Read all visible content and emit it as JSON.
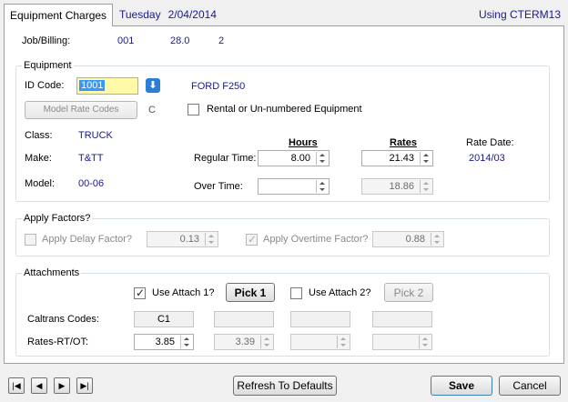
{
  "tabs": {
    "active_label": "Equipment Charges",
    "day": "Tuesday",
    "date": "2/04/2014",
    "using": "Using CTERM13"
  },
  "job": {
    "label": "Job/Billing:",
    "v1": "001",
    "v2": "28.0",
    "v3": "2"
  },
  "equipment": {
    "legend": "Equipment",
    "id_label": "ID Code:",
    "id_value": "1001",
    "description": "FORD F250",
    "model_rate_button": "Model Rate Codes",
    "rate_code": "C",
    "rental_label": "Rental or Un-numbered Equipment",
    "rental_checked": false,
    "class_label": "Class:",
    "class_value": "TRUCK",
    "make_label": "Make:",
    "make_value": "T&TT",
    "model_label": "Model:",
    "model_value": "00-06",
    "hours_header": "Hours",
    "rates_header": "Rates",
    "regular_label": "Regular Time:",
    "regular_hours": "8.00",
    "regular_rate": "21.43",
    "overtime_label": "Over Time:",
    "overtime_hours": "",
    "overtime_rate": "18.86",
    "rate_date_label": "Rate Date:",
    "rate_date_value": "2014/03"
  },
  "factors": {
    "legend": "Apply Factors?",
    "delay_label": "Apply Delay Factor?",
    "delay_checked": false,
    "delay_value": "0.13",
    "overtime_label": "Apply Overtime Factor?",
    "overtime_checked": true,
    "overtime_value": "0.88"
  },
  "attachments": {
    "legend": "Attachments",
    "attach1_label": "Use Attach 1?",
    "attach1_checked": true,
    "pick1": "Pick 1",
    "attach2_label": "Use Attach 2?",
    "attach2_checked": false,
    "pick2": "Pick 2",
    "caltrans_label": "Caltrans Codes:",
    "caltrans1": "C1",
    "rates_label": "Rates-RT/OT:",
    "rate1_rt": "3.85",
    "rate1_ot": "3.39"
  },
  "footer": {
    "refresh": "Refresh To Defaults",
    "save": "Save",
    "cancel": "Cancel",
    "nav_first": "|◀",
    "nav_prev": "◀",
    "nav_next": "▶",
    "nav_last": "▶|"
  },
  "colors": {
    "accent": "#1a1a8c",
    "id_highlight": "#fff9a8",
    "id_select": "#3399ff"
  }
}
